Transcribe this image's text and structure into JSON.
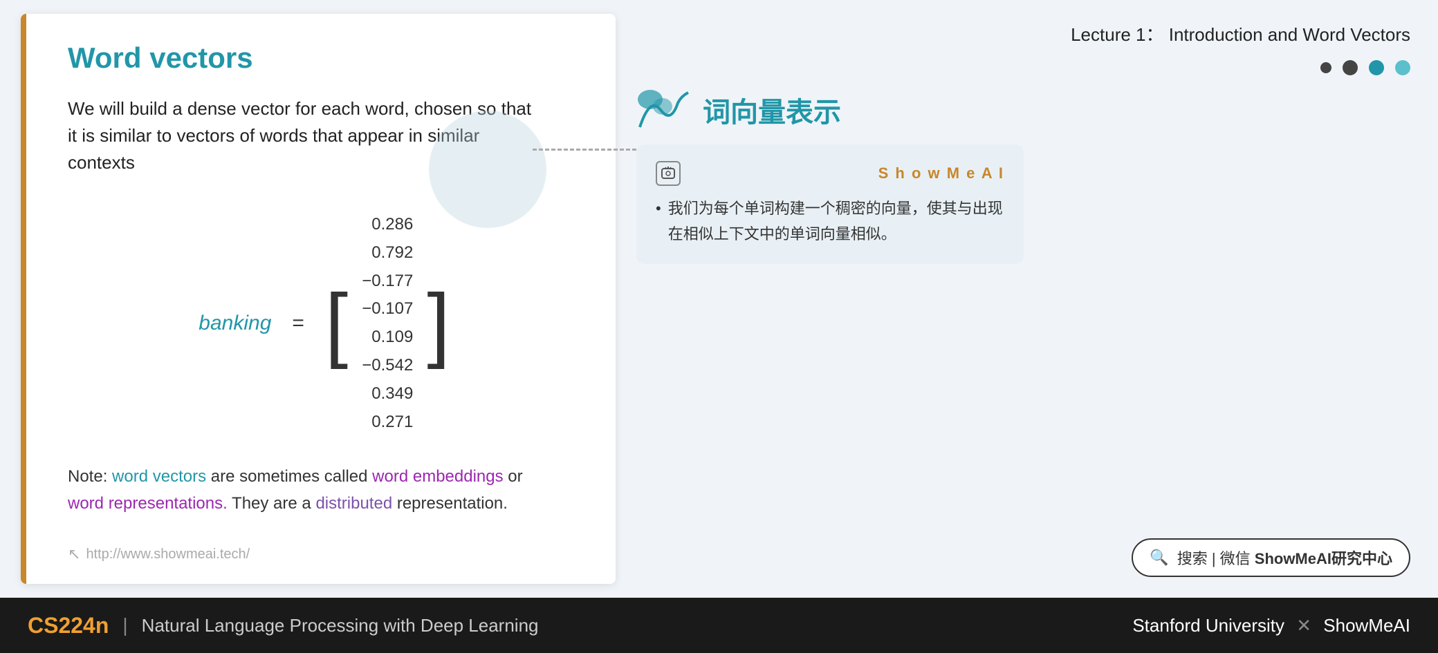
{
  "header": {
    "lecture_title": "Lecture 1： Introduction and Word Vectors"
  },
  "slide": {
    "title": "Word vectors",
    "body_text": "We will build a dense vector for each word, chosen so that it is similar to vectors of words that appear in similar contexts",
    "banking_label": "banking",
    "equals": "=",
    "matrix_values": [
      "0.286",
      "0.792",
      "−0.177",
      "−0.107",
      "0.109",
      "−0.542",
      "0.349",
      "0.271"
    ],
    "note_prefix": "Note: ",
    "note_word_vectors": "word vectors",
    "note_middle": " are sometimes called ",
    "note_word_embeddings": "word embeddings",
    "note_or": " or ",
    "note_word_representations": "word representations.",
    "note_end1": " They are a ",
    "note_distributed": "distributed",
    "note_end2": " representation.",
    "url": "http://www.showmeai.tech/"
  },
  "right_panel": {
    "lecture_title": "Lecture 1： Introduction and Word Vectors",
    "chinese_title": "词向量表示",
    "annotation": {
      "brand": "S h o w M e A I",
      "body": "我们为每个单词构建一个稠密的向量，使其与出现在相似上下文中的单词向量相似。"
    }
  },
  "search_bar": {
    "text": "搜索 | 微信 ",
    "bold_text": "ShowMeAI研究中心"
  },
  "footer": {
    "course_code": "CS224n",
    "divider": "|",
    "subtitle": "Natural Language Processing with Deep Learning",
    "right_text": "Stanford University",
    "x_text": "✕",
    "brand": "ShowMeAI"
  },
  "icons": {
    "search": "🔍",
    "cursor": "↖",
    "ai_symbol": "⊡"
  },
  "dots": [
    {
      "color": "dark",
      "size": "small"
    },
    {
      "color": "teal",
      "size": "normal"
    },
    {
      "color": "teal-light",
      "size": "normal"
    }
  ]
}
